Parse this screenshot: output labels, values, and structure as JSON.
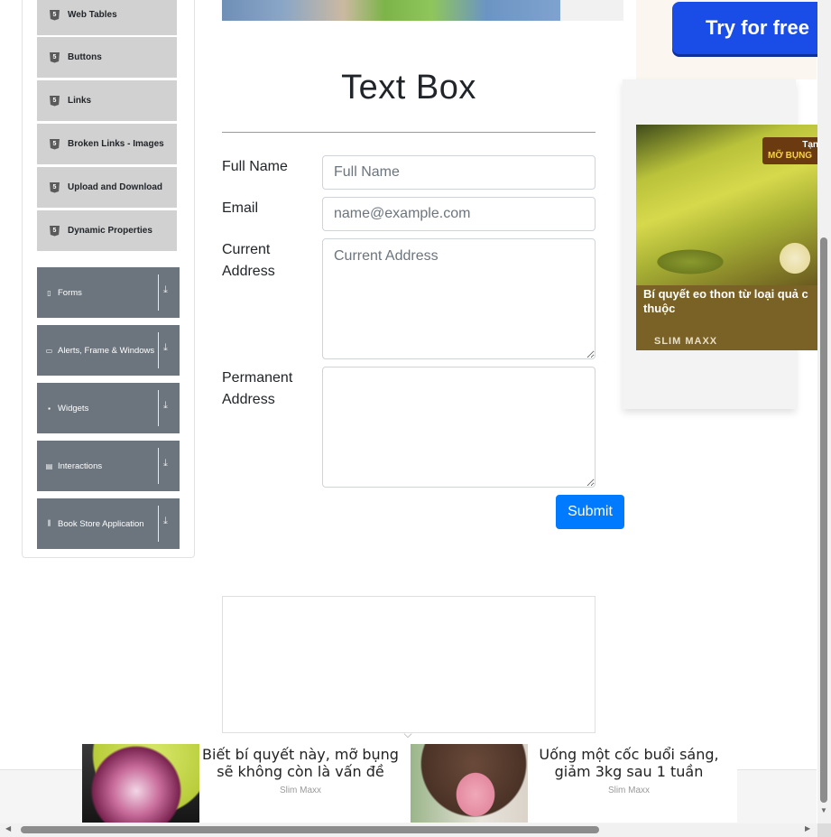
{
  "sidebar": {
    "elements": [
      {
        "label": "Web Tables",
        "icon": "html5-icon"
      },
      {
        "label": "Buttons",
        "icon": "html5-icon"
      },
      {
        "label": "Links",
        "icon": "html5-icon"
      },
      {
        "label": "Broken Links - Images",
        "icon": "html5-icon"
      },
      {
        "label": "Upload and Download",
        "icon": "html5-icon"
      },
      {
        "label": "Dynamic Properties",
        "icon": "html5-icon"
      }
    ],
    "groups": [
      {
        "label": "Forms",
        "icon": "form-icon"
      },
      {
        "label": "Alerts, Frame & Windows",
        "icon": "window-icon"
      },
      {
        "label": "Widgets",
        "icon": "grid-icon"
      },
      {
        "label": "Interactions",
        "icon": "list-icon"
      },
      {
        "label": "Book Store Application",
        "icon": "library-icon"
      }
    ]
  },
  "main": {
    "title": "Text Box",
    "form": {
      "full_name": {
        "label": "Full Name",
        "placeholder": "Full Name",
        "value": ""
      },
      "email": {
        "label": "Email",
        "placeholder": "name@example.com",
        "value": ""
      },
      "current_address": {
        "label": "Current Address",
        "placeholder": "Current Address",
        "value": ""
      },
      "permanent_address": {
        "label": "Permanent Address",
        "placeholder": "",
        "value": ""
      },
      "submit_label": "Submit"
    }
  },
  "ads": {
    "right_cta": "Try for free",
    "right_card": {
      "tag_top": "Tạn",
      "tag_bottom": "MỠ BỤNG",
      "headline_line1": "Bí quyết eo thon từ loại quả c",
      "headline_line2": "thuộc",
      "brand": "SLIM MAXX"
    },
    "bottom": [
      {
        "text": "Biết bí quyết này, mỡ bụng sẽ không còn là vấn đề",
        "source": "Slim Maxx"
      },
      {
        "text": "Uống một cốc buổi sáng, giảm 3kg sau 1 tuần",
        "source": "Slim Maxx"
      }
    ]
  },
  "colors": {
    "primary": "#007bff",
    "sidebar_group": "#6c757d",
    "sidebar_item": "#d1d1d1",
    "cta_blue": "#1a4de8"
  }
}
